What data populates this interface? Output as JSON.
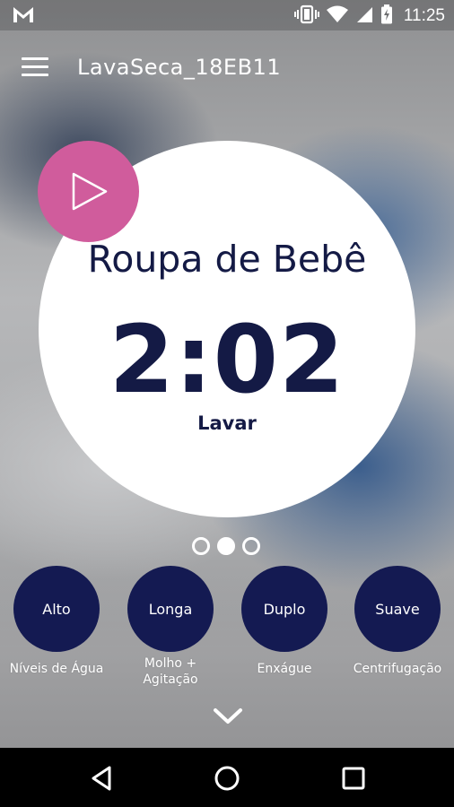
{
  "status_bar": {
    "time": "11:25",
    "icons": [
      "gmail-icon",
      "vibrate-icon",
      "wifi-icon",
      "signal-icon",
      "battery-charging-icon"
    ]
  },
  "app_bar": {
    "title": "LavaSeca_18EB11",
    "menu_icon": "hamburger-menu-icon"
  },
  "program": {
    "name": "Roupa de Bebê",
    "time_remaining": "2:02",
    "phase": "Lavar",
    "play_icon": "play-icon",
    "accent_color": "#d05c9c"
  },
  "pager": {
    "count": 3,
    "active_index": 1
  },
  "options": [
    {
      "value": "Alto",
      "label_lines": [
        "Níveis de Água"
      ]
    },
    {
      "value": "Longa",
      "label_lines": [
        "Molho +",
        "Agitação"
      ]
    },
    {
      "value": "Duplo",
      "label_lines": [
        "Enxágue"
      ]
    },
    {
      "value": "Suave",
      "label_lines": [
        "Centrifugação"
      ]
    }
  ],
  "colors": {
    "primary_dark": "#141a52",
    "text_dark": "#141a45"
  },
  "expand_icon": "chevron-down-icon",
  "nav_bar": {
    "icons": [
      "back-icon",
      "home-icon",
      "recents-icon"
    ]
  }
}
